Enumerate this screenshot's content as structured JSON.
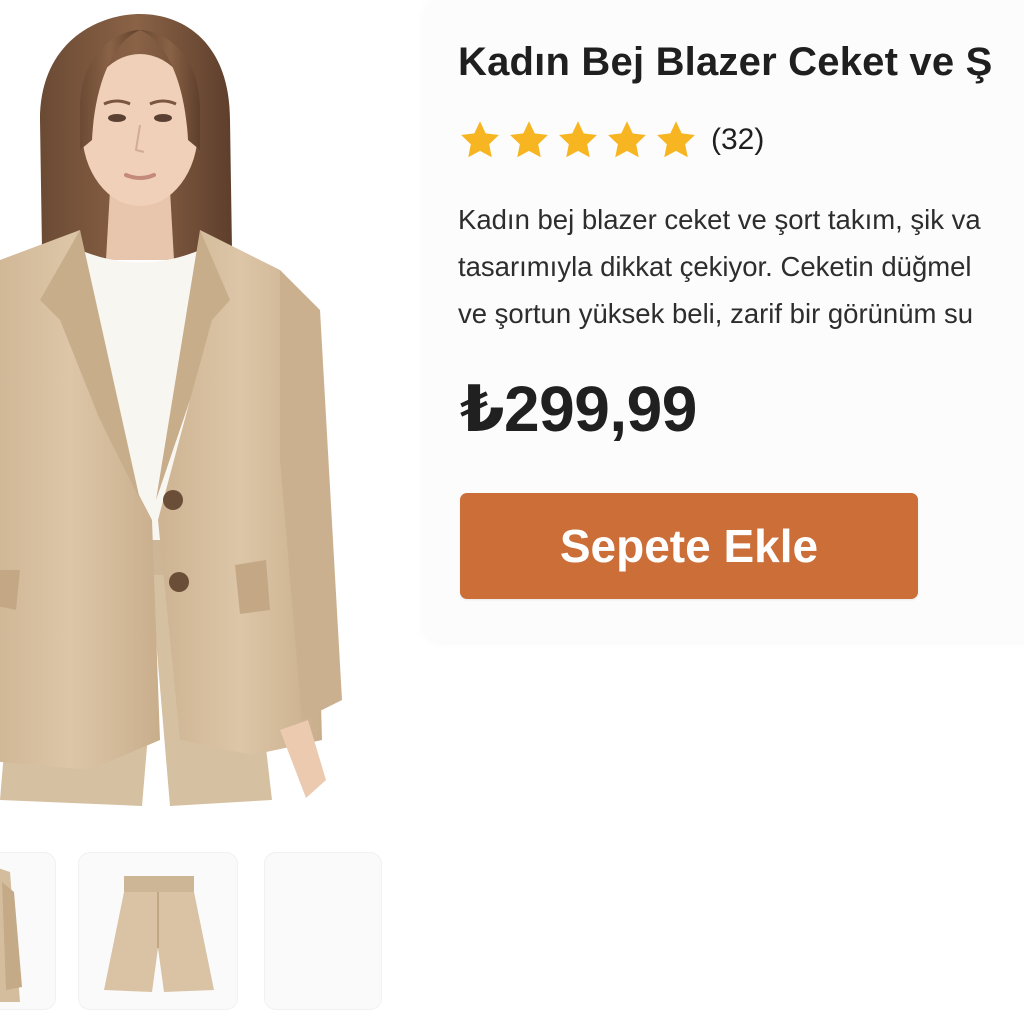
{
  "product": {
    "title": "Kadın Bej Blazer Ceket ve Ş",
    "rating": {
      "stars": 5,
      "count": "(32)"
    },
    "description": [
      "Kadın bej blazer ceket ve şort takım, şik va",
      "tasarımıyla dikkat çekiyor. Ceketin düğmel",
      "ve şortun yüksek beli, zarif bir görünüm su"
    ],
    "price": "₺299,99",
    "add_to_cart": "Sepete Ekle"
  },
  "gallery": {
    "main_image": "model-beige-blazer-shorts-set",
    "thumbnails": [
      "blazer-side-view",
      "beige-shorts",
      "blank"
    ]
  },
  "colors": {
    "accent": "#CB6E38",
    "star": "#F6B521",
    "beige": "#D8C1A2"
  }
}
